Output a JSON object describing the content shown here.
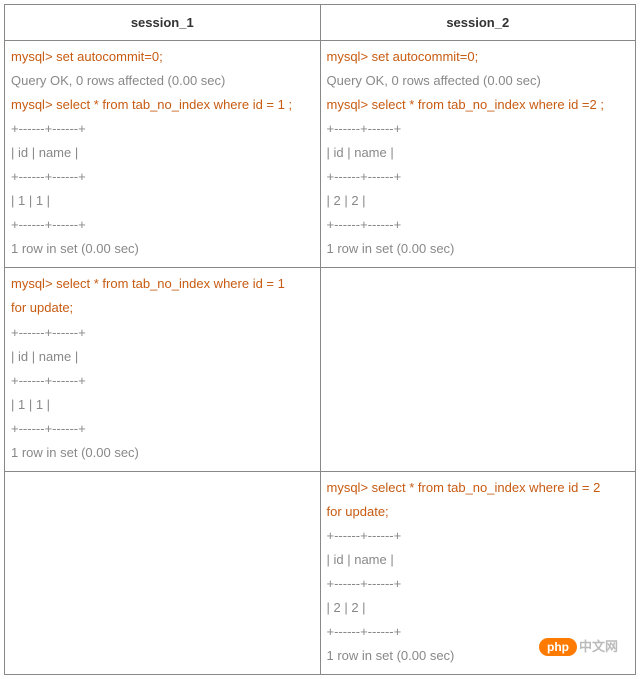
{
  "headers": {
    "col1": "session_1",
    "col2": "session_2"
  },
  "row1": {
    "s1": {
      "l1": "mysql> set autocommit=0;",
      "l2": "Query OK, 0 rows affected (0.00 sec)",
      "l3": "mysql> select * from tab_no_index where id = 1 ;",
      "l4": "+------+------+",
      "l5": "| id      | name |",
      "l6": "+------+------+",
      "l7": "| 1       | 1        |",
      "l8": "+------+------+",
      "l9": "1 row in set (0.00 sec)"
    },
    "s2": {
      "l1": "mysql> set autocommit=0;",
      "l2": "Query OK, 0 rows affected (0.00 sec)",
      "l3": "mysql> select * from tab_no_index where id =2 ;",
      "l4": "+------+------+",
      "l5": "| id      | name |",
      "l6": "+------+------+",
      "l7": "| 2       | 2        |",
      "l8": "+------+------+",
      "l9": "1 row in set (0.00 sec)"
    }
  },
  "row2": {
    "s1": {
      "l1": "mysql> select * from tab_no_index where id = 1",
      "l2": "for update;",
      "l3": "+------+------+",
      "l4": "| id      | name |",
      "l5": "+------+------+",
      "l6": "| 1       | 1        |",
      "l7": "+------+------+",
      "l8": "1 row in set (0.00 sec)"
    }
  },
  "row3": {
    "s2": {
      "l1": "mysql> select * from tab_no_index where id = 2",
      "l2": "for update;",
      "l3": "+------+------+",
      "l4": "| id      | name |",
      "l5": "+------+------+",
      "l6": "| 2       | 2        |",
      "l7": "+------+------+",
      "l8": "1 row in set (0.00 sec)"
    }
  },
  "watermark": {
    "pill": "php",
    "text": "中文网"
  }
}
